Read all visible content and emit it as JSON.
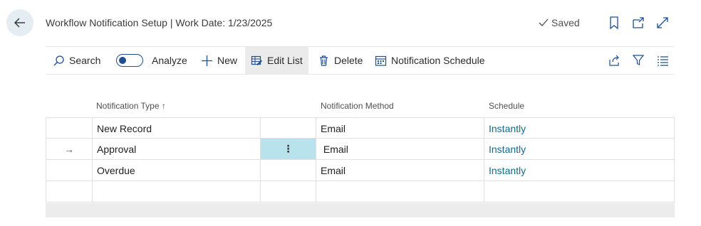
{
  "header": {
    "title": "Workflow Notification Setup | Work Date: 1/23/2025",
    "saved_label": "Saved"
  },
  "toolbar": {
    "search_label": "Search",
    "analyze_label": "Analyze",
    "new_label": "New",
    "edit_list_label": "Edit List",
    "delete_label": "Delete",
    "notification_schedule_label": "Notification Schedule"
  },
  "table": {
    "columns": [
      "Notification Type ↑",
      "Notification Method",
      "Schedule"
    ],
    "rows": [
      {
        "marker": "",
        "type": "New Record",
        "menu": "",
        "method": "Email",
        "schedule": "Instantly"
      },
      {
        "marker": "→",
        "type": "Approval",
        "menu": "⋮",
        "method": " Email",
        "schedule": "Instantly"
      },
      {
        "marker": "",
        "type": "Overdue",
        "menu": "",
        "method": "Email",
        "schedule": "Instantly"
      },
      {
        "marker": "",
        "type": "",
        "menu": "",
        "method": "",
        "schedule": ""
      }
    ]
  },
  "colors": {
    "accent": "#1d4f91",
    "link": "#0f6b8a",
    "selected_cell": "#b8e2ec"
  }
}
